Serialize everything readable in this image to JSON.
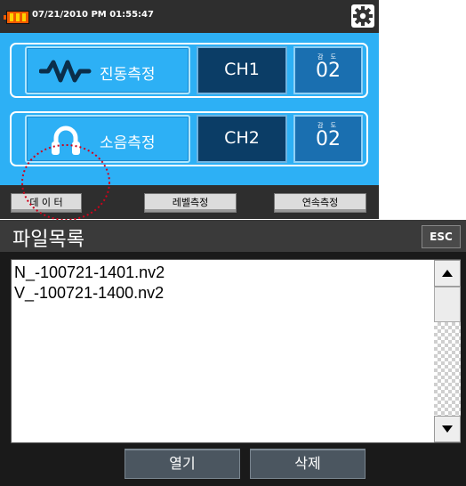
{
  "status": {
    "datetime": "07/21/2010 PM 01:55:47",
    "icons": {
      "battery": "battery-icon",
      "settings": "gear-icon"
    }
  },
  "measure": [
    {
      "label": "진동측정",
      "icon": "vibration-wave-icon",
      "channel": "CH1",
      "gain_label": "감 도",
      "gain_value": "02"
    },
    {
      "label": "소음측정",
      "icon": "headphones-icon",
      "channel": "CH2",
      "gain_label": "감 도",
      "gain_value": "02"
    }
  ],
  "tabs": [
    "데 이 터",
    "레벨측정",
    "연속측정"
  ],
  "file_list": {
    "title": "파일목록",
    "esc_label": "ESC",
    "files": [
      "N_-100721-1401.nv2",
      "V_-100721-1400.nv2"
    ],
    "open_label": "열기",
    "delete_label": "삭제"
  },
  "colors": {
    "panel_blue": "#2db0f5",
    "channel_navy": "#0b3d66",
    "bar_dark": "#2e2e2e",
    "highlight_red": "#d0021b"
  }
}
